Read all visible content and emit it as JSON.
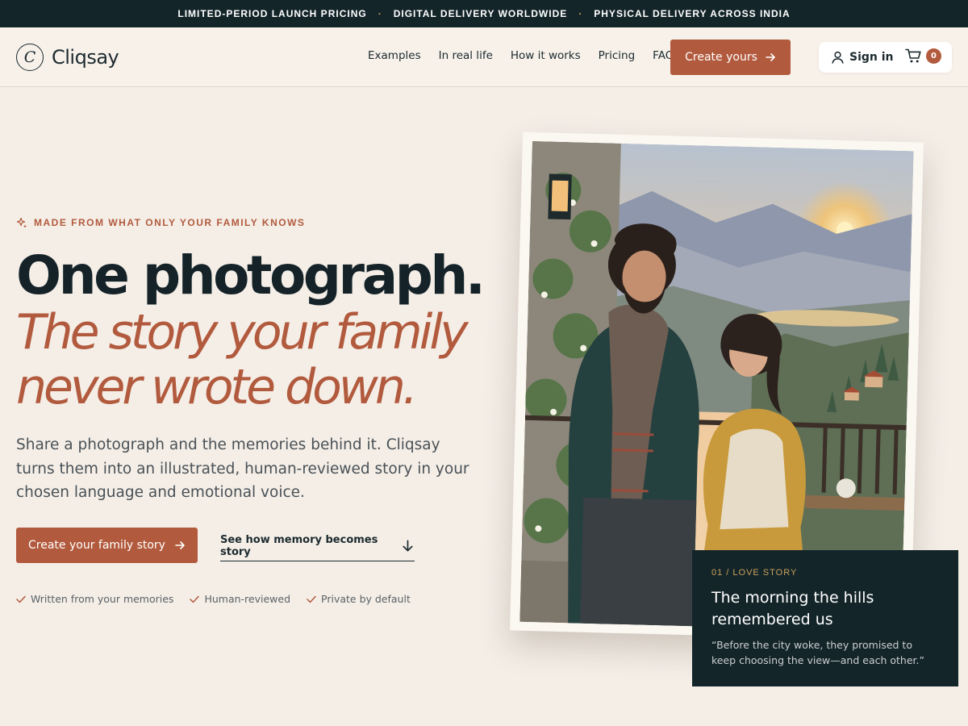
{
  "announcement": {
    "items": [
      "LIMITED-PERIOD LAUNCH PRICING",
      "DIGITAL DELIVERY WORLDWIDE",
      "PHYSICAL DELIVERY ACROSS INDIA"
    ],
    "separator": "·"
  },
  "header": {
    "logo_letter": "C",
    "brand": "Cliqsay",
    "nav": [
      "Examples",
      "In real life",
      "How it works",
      "Pricing",
      "FAQ"
    ],
    "cta_label": "Create yours",
    "signin_label": "Sign in",
    "cart_count": "0"
  },
  "hero": {
    "eyebrow": "MADE FROM WHAT ONLY YOUR FAMILY KNOWS",
    "headline": "One photograph.",
    "headline_accent": "The story your family never wrote down.",
    "lead": "Share a photograph and the memories behind it. Cliqsay turns them into an illustrated, human-reviewed story in your chosen language and emotional voice.",
    "primary_cta": "Create your family story",
    "secondary_cta": "See how memory becomes story",
    "checks": [
      "Written from your memories",
      "Human-reviewed",
      "Private by default"
    ]
  },
  "story_card": {
    "tag": "01 / LOVE STORY",
    "title": "The morning the hills remembered us",
    "quote": "“Before the city woke, they promised to keep choosing the view—and each other.”"
  },
  "colors": {
    "accent": "#b25a3d",
    "dark": "#14252a",
    "background": "#f4eee7",
    "gold": "#c8a15a"
  },
  "icons": [
    "sparkle-icon",
    "arrow-right-icon",
    "arrow-down-icon",
    "user-icon",
    "cart-icon",
    "check-icon"
  ]
}
